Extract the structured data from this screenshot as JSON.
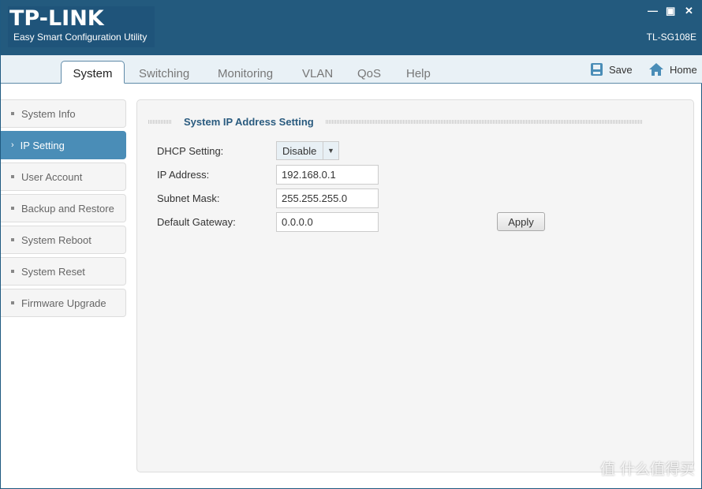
{
  "header": {
    "logo": "TP-LINK",
    "subtitle": "Easy Smart Configuration Utility",
    "model": "TL-SG108E",
    "window_controls": [
      "minimize-icon",
      "maximize-icon",
      "close-icon"
    ]
  },
  "tabs": [
    {
      "label": "System",
      "active": true
    },
    {
      "label": "Switching"
    },
    {
      "label": "Monitoring"
    },
    {
      "label": "VLAN"
    },
    {
      "label": "QoS"
    },
    {
      "label": "Help"
    }
  ],
  "toolbar": {
    "save": "Save",
    "home": "Home"
  },
  "sidebar": {
    "items": [
      {
        "label": "System Info"
      },
      {
        "label": "IP Setting",
        "active": true
      },
      {
        "label": "User Account"
      },
      {
        "label": "Backup and Restore"
      },
      {
        "label": "System Reboot"
      },
      {
        "label": "System Reset"
      },
      {
        "label": "Firmware Upgrade"
      }
    ]
  },
  "main": {
    "section_title": "System IP Address Setting",
    "dhcp": {
      "label": "DHCP Setting:",
      "value": "Disable"
    },
    "ip": {
      "label": "IP Address:",
      "value": "192.168.0.1"
    },
    "mask": {
      "label": "Subnet Mask:",
      "value": "255.255.255.0"
    },
    "gateway": {
      "label": "Default Gateway:",
      "value": "0.0.0.0"
    },
    "apply": "Apply"
  },
  "colors": {
    "header": "#235a7e",
    "active_item": "#4a8db7",
    "section_title": "#2a5b7f"
  },
  "watermark": "值 什么值得买"
}
